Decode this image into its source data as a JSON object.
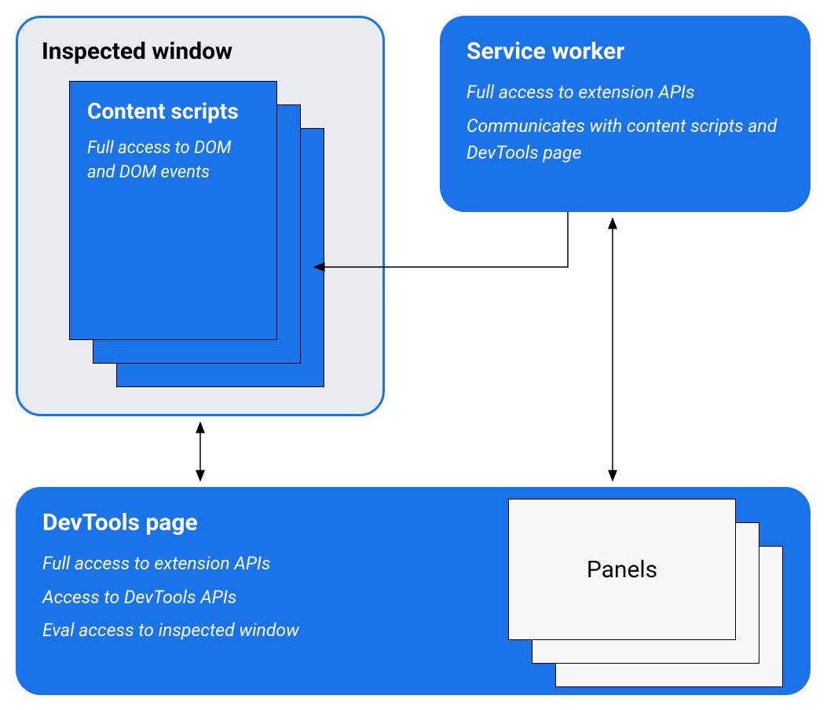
{
  "inspected_window": {
    "title": "Inspected window",
    "content_scripts": {
      "title": "Content scripts",
      "desc": "Full access to DOM and DOM events"
    }
  },
  "service_worker": {
    "title": "Service worker",
    "desc1": "Full access to extension APIs",
    "desc2": "Communicates with content scripts and DevTools page"
  },
  "devtools_page": {
    "title": "DevTools page",
    "desc1": "Full access to extension APIs",
    "desc2": "Access to DevTools APIs",
    "desc3": "Eval access to inspected window",
    "panels_label": "Panels"
  },
  "colors": {
    "blue": "#1a73e8",
    "lightgray_bg": "#e9edf2",
    "panel_bg": "#f7f7f7"
  }
}
